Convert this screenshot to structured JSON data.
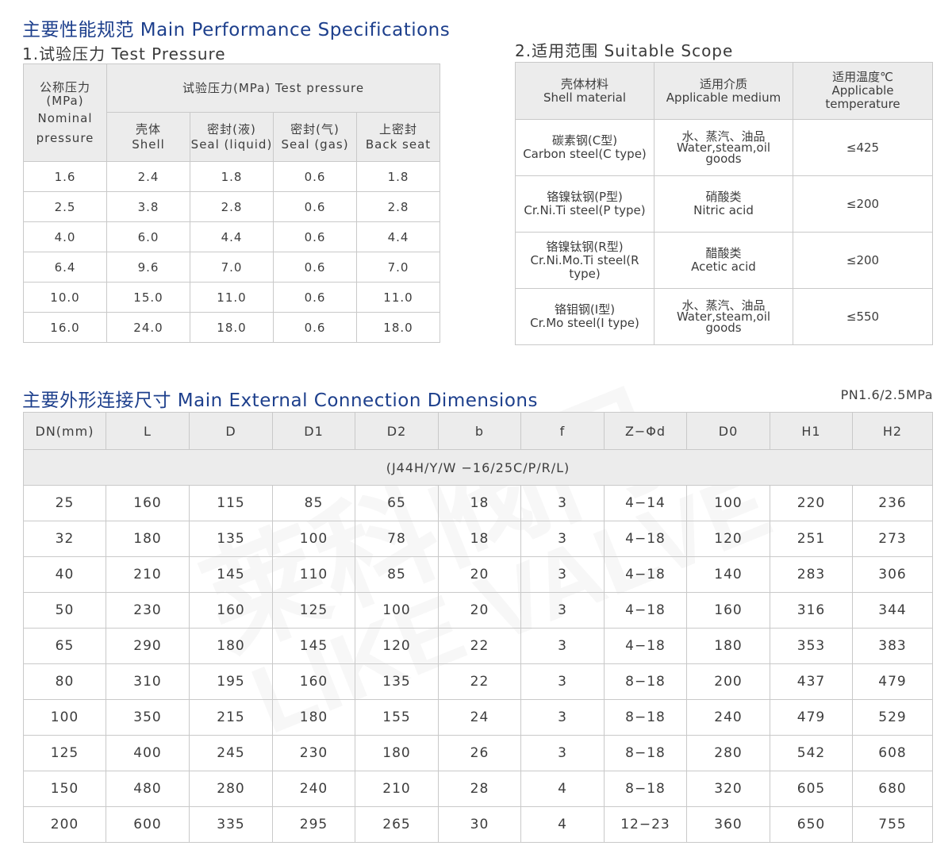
{
  "section1": {
    "title": "主要性能规范 Main Performance Specifications",
    "sub1_title": "1.试验压力 Test  Pressure",
    "sub2_title": "2.适用范围  Suitable  Scope"
  },
  "test_pressure": {
    "nominal_header": [
      "公称压力",
      "(MPa)",
      "Nominal",
      "pressure"
    ],
    "group_header": "试验压力(MPa)  Test  pressure",
    "columns": [
      {
        "cn": "壳体",
        "en": "Shell"
      },
      {
        "cn": "密封(液)",
        "en": "Seal (liquid)"
      },
      {
        "cn": "密封(气)",
        "en": "Seal (gas)"
      },
      {
        "cn": "上密封",
        "en": "Back  seat"
      }
    ],
    "rows": [
      [
        "1.6",
        "2.4",
        "1.8",
        "0.6",
        "1.8"
      ],
      [
        "2.5",
        "3.8",
        "2.8",
        "0.6",
        "2.8"
      ],
      [
        "4.0",
        "6.0",
        "4.4",
        "0.6",
        "4.4"
      ],
      [
        "6.4",
        "9.6",
        "7.0",
        "0.6",
        "7.0"
      ],
      [
        "10.0",
        "15.0",
        "11.0",
        "0.6",
        "11.0"
      ],
      [
        "16.0",
        "24.0",
        "18.0",
        "0.6",
        "18.0"
      ]
    ]
  },
  "scope": {
    "headers": [
      [
        "壳体材料",
        "Shell material"
      ],
      [
        "适用介质",
        "Applicable medium"
      ],
      [
        "适用温度℃",
        "Applicable",
        "temperature"
      ]
    ],
    "rows": [
      {
        "material": [
          "碳素钢(C型)",
          "Carbon steel(C type)"
        ],
        "medium": [
          "水、蒸汽、油品",
          "Water,steam,oil",
          "goods"
        ],
        "temp": "≤425"
      },
      {
        "material": [
          "铬镍钛钢(P型)",
          "Cr.Ni.Ti steel(P type)"
        ],
        "medium": [
          "硝酸类",
          "Nitric acid"
        ],
        "temp": "≤200"
      },
      {
        "material": [
          "铬镍钛钢(R型)",
          "Cr.Ni.Mo.Ti  steel(R type)"
        ],
        "medium": [
          "醋酸类",
          "Acetic  acid"
        ],
        "temp": "≤200"
      },
      {
        "material": [
          "铬钼钢(I型)",
          "Cr.Mo steel(I type)"
        ],
        "medium": [
          "水、蒸汽、油品",
          "Water,steam,oil",
          "goods"
        ],
        "temp": "≤550"
      }
    ]
  },
  "section2": {
    "title": "主要外形连接尺寸 Main External Connection Dimensions",
    "pn_label": "PN1.6/2.5MPa"
  },
  "dimensions": {
    "headers": [
      "DN(mm)",
      "L",
      "D",
      "D1",
      "D2",
      "b",
      "f",
      "Z−Φd",
      "D0",
      "H1",
      "H2"
    ],
    "model": "(J44H/Y/W −16/25C/P/R/L)",
    "rows": [
      [
        "25",
        "160",
        "115",
        "85",
        "65",
        "18",
        "3",
        "4−14",
        "100",
        "220",
        "236"
      ],
      [
        "32",
        "180",
        "135",
        "100",
        "78",
        "18",
        "3",
        "4−18",
        "120",
        "251",
        "273"
      ],
      [
        "40",
        "210",
        "145",
        "110",
        "85",
        "20",
        "3",
        "4−18",
        "140",
        "283",
        "306"
      ],
      [
        "50",
        "230",
        "160",
        "125",
        "100",
        "20",
        "3",
        "4−18",
        "160",
        "316",
        "344"
      ],
      [
        "65",
        "290",
        "180",
        "145",
        "120",
        "22",
        "3",
        "4−18",
        "180",
        "353",
        "383"
      ],
      [
        "80",
        "310",
        "195",
        "160",
        "135",
        "22",
        "3",
        "8−18",
        "200",
        "437",
        "479"
      ],
      [
        "100",
        "350",
        "215",
        "180",
        "155",
        "24",
        "3",
        "8−18",
        "240",
        "479",
        "529"
      ],
      [
        "125",
        "400",
        "245",
        "230",
        "180",
        "26",
        "3",
        "8−18",
        "280",
        "542",
        "608"
      ],
      [
        "150",
        "480",
        "280",
        "240",
        "210",
        "28",
        "4",
        "8−18",
        "320",
        "605",
        "680"
      ],
      [
        "200",
        "600",
        "335",
        "295",
        "265",
        "30",
        "4",
        "12−23",
        "360",
        "650",
        "755"
      ]
    ]
  },
  "watermark": {
    "cn": "莱科阀门",
    "en": "LIKE VALVE"
  }
}
